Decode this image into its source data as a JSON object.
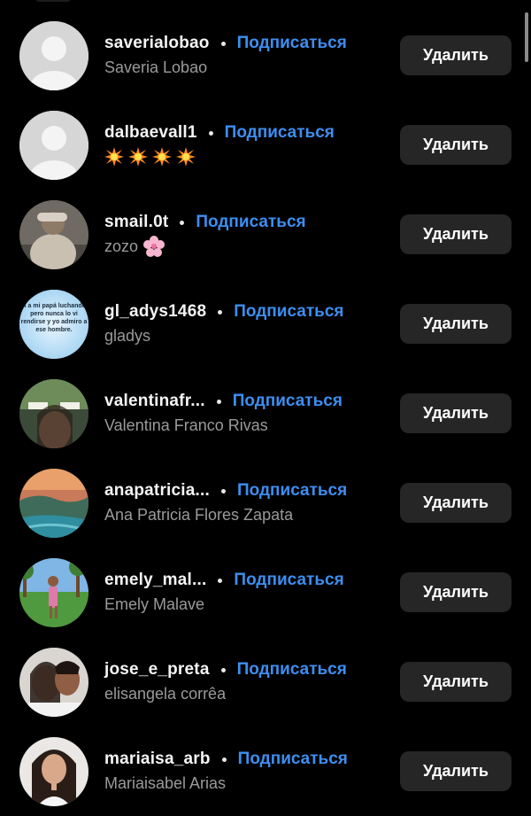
{
  "follow_label": "Подписаться",
  "remove_label": "Удалить",
  "colors": {
    "background": "#000000",
    "accent": "#3d8ef0",
    "button_bg": "#262626",
    "subtext": "#9a9a9a"
  },
  "rows": [
    {
      "username": "saverialobao",
      "name": "Saveria Lobao",
      "avatar": "default-avatar"
    },
    {
      "username": "dalbaevall1",
      "name": "",
      "emoji": [
        "💥",
        "💥",
        "💥",
        "💥"
      ],
      "avatar": "default-avatar"
    },
    {
      "username": "smail.0t",
      "name": "zozo",
      "emoji_after": "🌸",
      "avatar": "photo"
    },
    {
      "username": "gl_adys1468",
      "name": "gladys",
      "avatar": "quote-image",
      "avatar_text": "Vi a mi papá luchando, pero nunca lo vi rendirse y yo admiro a ese hombre."
    },
    {
      "username": "valentinafr...",
      "name": "Valentina Franco Rivas",
      "avatar": "photo"
    },
    {
      "username": "anapatricia...",
      "name": "Ana Patricia Flores Zapata",
      "avatar": "photo"
    },
    {
      "username": "emely_mal...",
      "name": "Emely Malave",
      "avatar": "photo"
    },
    {
      "username": "jose_e_preta",
      "name": "elisangela corrêa",
      "avatar": "photo"
    },
    {
      "username": "mariaisa_arb",
      "name": "Mariaisabel Arias",
      "avatar": "photo"
    }
  ]
}
